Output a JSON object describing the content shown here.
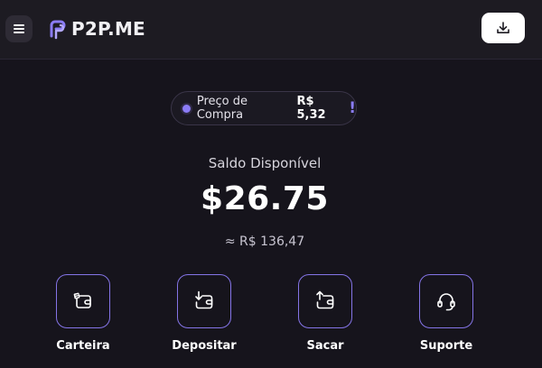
{
  "app": {
    "logo_text": "P2P.ME",
    "accent_color": "#8474e6"
  },
  "header": {
    "menu_icon": "hamburger-menu-icon",
    "download_icon": "download-icon"
  },
  "price": {
    "label": "Preço de Compra",
    "value": "R$ 5,32",
    "alert": "!"
  },
  "balance": {
    "label": "Saldo Disponível",
    "value": "$26.75",
    "converted": "≈  R$ 136,47"
  },
  "actions": [
    {
      "label": "Carteira",
      "icon": "wallet-icon"
    },
    {
      "label": "Depositar",
      "icon": "deposit-icon"
    },
    {
      "label": "Sacar",
      "icon": "withdraw-icon"
    },
    {
      "label": "Suporte",
      "icon": "headset-icon"
    }
  ]
}
